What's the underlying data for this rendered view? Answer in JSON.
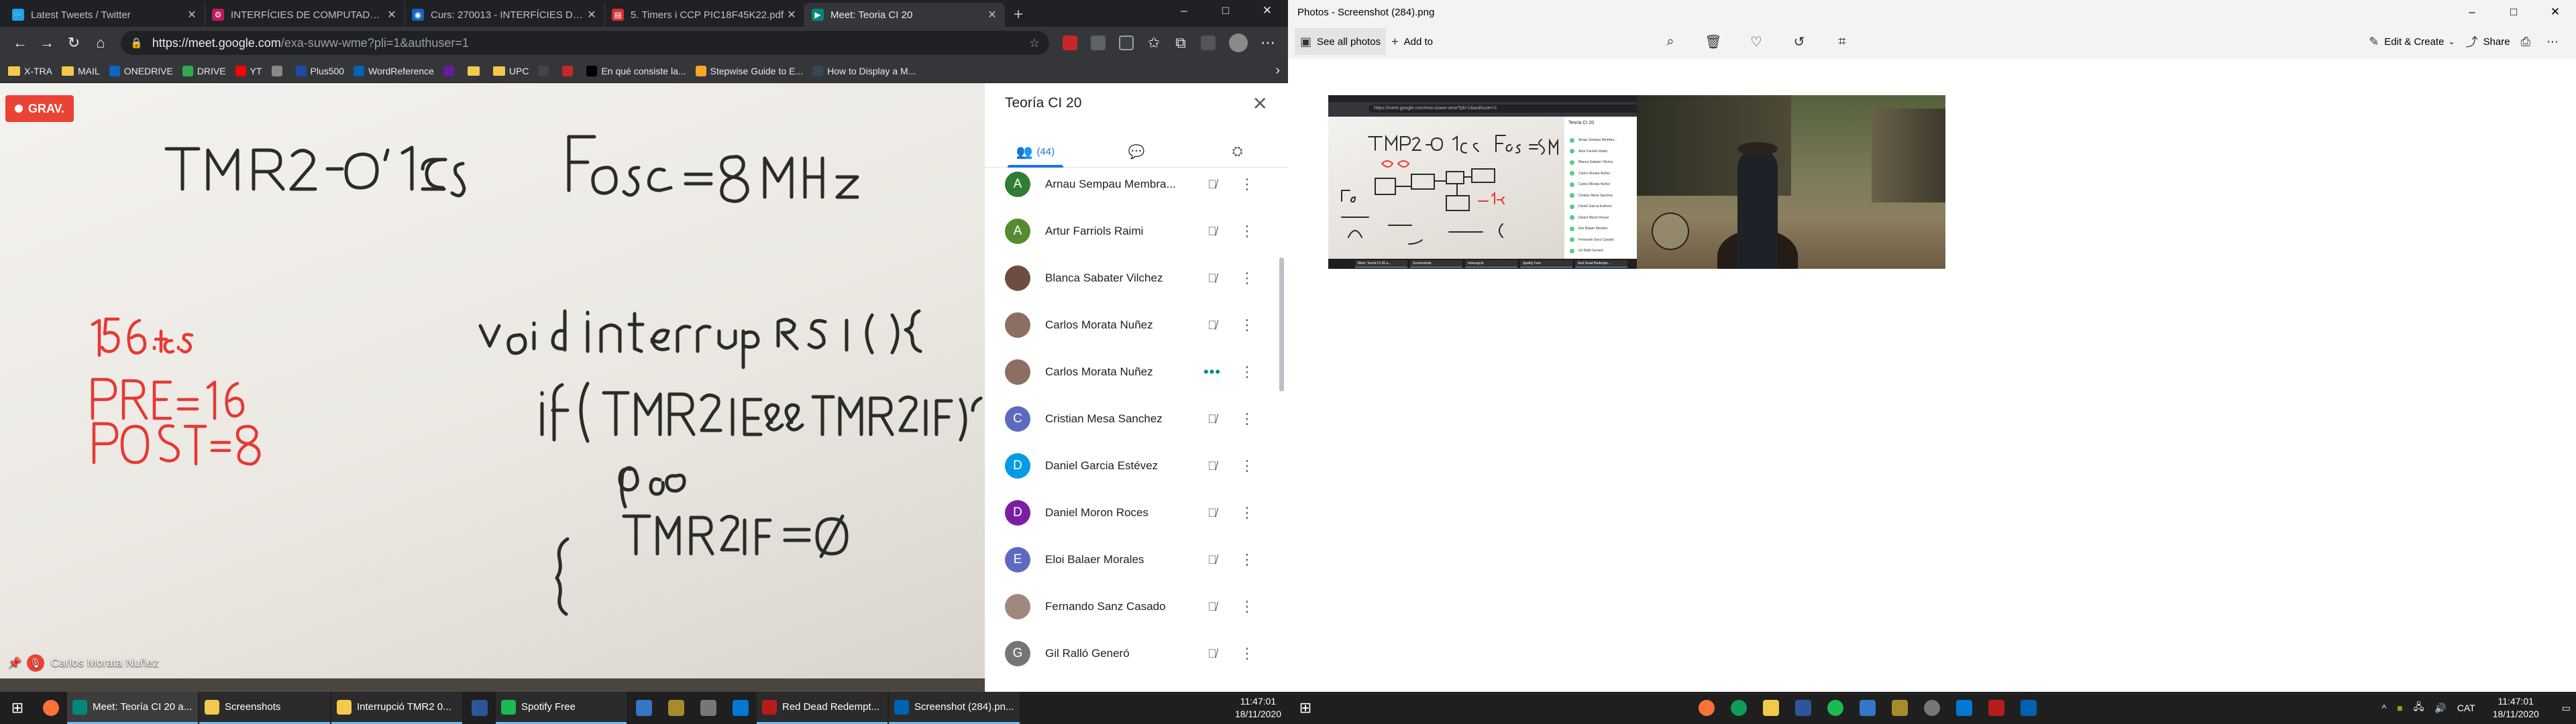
{
  "left": {
    "tabs": [
      {
        "title": "Latest Tweets / Twitter",
        "color": "#1da1f2",
        "glyph": "🐦"
      },
      {
        "title": "INTERFÍCIES DE COMPUTADORS",
        "color": "#c2185b",
        "glyph": "⚙"
      },
      {
        "title": "Curs: 270013 - INTERFÍCIES DE C",
        "color": "#1565c0",
        "glyph": "◉"
      },
      {
        "title": "5. Timers i CCP PIC18F45K22.pdf",
        "color": "#d32f2f",
        "glyph": "▤"
      },
      {
        "title": "Meet: Teoria CI 20",
        "color": "#00897b",
        "glyph": "▶",
        "active": true
      }
    ],
    "url_host": "https://meet.google.com",
    "url_path": "/exa-suww-wme?pli=1&authuser=1",
    "bookmarks": [
      {
        "label": "X-TRA",
        "type": "folder"
      },
      {
        "label": "MAIL",
        "type": "folder"
      },
      {
        "label": "ONEDRIVE",
        "type": "icon",
        "color": "#0a66c2"
      },
      {
        "label": "DRIVE",
        "type": "icon",
        "color": "#34a853"
      },
      {
        "label": "YT",
        "type": "icon",
        "color": "#ff0000"
      },
      {
        "label": "",
        "type": "icon",
        "color": "#888888"
      },
      {
        "label": "Plus500",
        "type": "icon",
        "color": "#1f4aa8"
      },
      {
        "label": "WordReference",
        "type": "icon",
        "color": "#0064b0"
      },
      {
        "label": "",
        "type": "icon",
        "color": "#6a1b9a"
      },
      {
        "label": "",
        "type": "folder"
      },
      {
        "label": "UPC",
        "type": "folder"
      },
      {
        "label": "",
        "type": "icon",
        "color": "#444444"
      },
      {
        "label": "",
        "type": "icon",
        "color": "#c62828"
      },
      {
        "label": "En qué consiste la...",
        "type": "icon",
        "color": "#000000"
      },
      {
        "label": "Stepwise Guide to E...",
        "type": "icon",
        "color": "#f9a825"
      },
      {
        "label": "How to Display a M...",
        "type": "icon",
        "color": "#37474f"
      }
    ],
    "rec_label": "GRAV.",
    "speaker_name": "Carlos Morata Nuñez",
    "panel": {
      "title": "Teoría CI 20",
      "people_count": "(44)",
      "participants": [
        {
          "initial": "A",
          "name": "Arnau Sempau Membra...",
          "color": "#2e7d32",
          "state": "muted"
        },
        {
          "initial": "A",
          "name": "Artur Farriols Raimi",
          "color": "#558b2f",
          "state": "muted"
        },
        {
          "initial": "",
          "name": "Blanca Sabater Vilchez",
          "color": "#6d4c41",
          "state": "muted"
        },
        {
          "initial": "",
          "name": "Carlos Morata Nuñez",
          "color": "#8d6e63",
          "state": "muted"
        },
        {
          "initial": "",
          "name": "Carlos Morata Nuñez",
          "color": "#8d6e63",
          "state": "speaking"
        },
        {
          "initial": "C",
          "name": "Cristian Mesa Sanchez",
          "color": "#5c6bc0",
          "state": "muted"
        },
        {
          "initial": "D",
          "name": "Daniel Garcia Estévez",
          "color": "#039be5",
          "state": "muted"
        },
        {
          "initial": "D",
          "name": "Daniel Moron Roces",
          "color": "#7b1fa2",
          "state": "muted"
        },
        {
          "initial": "E",
          "name": "Eloi Balaer Morales",
          "color": "#5c6bc0",
          "state": "muted"
        },
        {
          "initial": "",
          "name": "Fernando Sanz Casado",
          "color": "#a1887f",
          "state": "muted"
        },
        {
          "initial": "G",
          "name": "Gil Ralló Generó",
          "color": "#757575",
          "state": "muted"
        }
      ]
    },
    "taskbar": [
      {
        "label": "Meet: Teoría CI 20 a...",
        "color": "#00897b"
      },
      {
        "label": "Screenshots",
        "color": "#f2c94c"
      },
      {
        "label": "Interrupció TMR2 0...",
        "color": "#f2c94c"
      },
      {
        "label": "",
        "color": "#2b579a"
      },
      {
        "label": "Spotify Free",
        "color": "#1db954"
      },
      {
        "label": "",
        "color": "#3478c6"
      },
      {
        "label": "",
        "color": "#a88b2c"
      },
      {
        "label": "",
        "color": "#777777"
      },
      {
        "label": "",
        "color": "#0078d4"
      },
      {
        "label": "Red Dead Redempt...",
        "color": "#b71c1c"
      },
      {
        "label": "Screenshot (284).pn...",
        "color": "#0063b1"
      }
    ],
    "time": "11:47:01",
    "date": "18/11/2020"
  },
  "right": {
    "window_title": "Photos - Screenshot (284).png",
    "see_all": "See all photos",
    "add_to": "Add to",
    "edit_create": "Edit & Create",
    "share": "Share",
    "mini": {
      "url": "https://meet.google.com/exa-suww-wme?pli=1&authuser=1",
      "panel_title": "Teoría CI 20",
      "rows": [
        "Arnau Sempau Membra...",
        "Artur Farriols Raimi",
        "Blanca Sabater Vilchez",
        "Carlos Morata Nuñez",
        "Carlos Morata Nuñez",
        "Cristian Mesa Sanchez",
        "Daniel García Estévez",
        "Daniel Moron Roces",
        "Eloi Balaer Morales",
        "Fernando Sanz Casado",
        "Gil Ralló Generó"
      ],
      "tasks": [
        "Meet: Teoría CI 20 a...",
        "Screenshots",
        "Interrupció",
        "Spotify Free",
        "Red Dead Redempt..."
      ]
    },
    "tray_lang": "CAT",
    "time": "11:47:01",
    "date": "18/11/2020"
  }
}
